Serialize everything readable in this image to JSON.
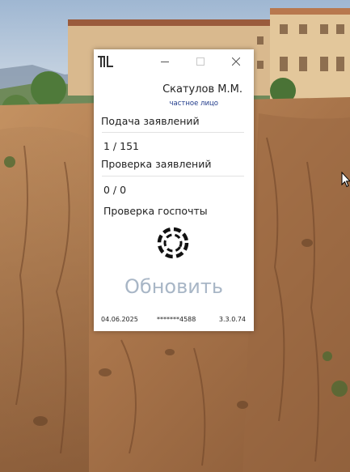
{
  "window": {
    "logo_icon": "app-logo-icon",
    "controls": {
      "minimize_icon": "minimize-icon",
      "maximize_icon": "maximize-icon",
      "close_icon": "close-icon"
    }
  },
  "user": {
    "name": "Скатулов М.М.",
    "type": "частное лицо"
  },
  "sections": [
    {
      "label": "Подача заявлений",
      "value": "1 / 151"
    },
    {
      "label": "Проверка заявлений",
      "value": "0 / 0"
    },
    {
      "label": "Проверка госпочты",
      "value": ""
    }
  ],
  "status": {
    "icon": "loading-spinner-icon"
  },
  "actions": {
    "refresh_label": "Обновить"
  },
  "footer": {
    "date": "04.06.2025",
    "phone": "*******4588",
    "version": "3.3.0.74"
  },
  "colors": {
    "accent_muted": "#a8b6c6",
    "user_type": "#1f3a8a",
    "window_bg": "#ffffff"
  }
}
